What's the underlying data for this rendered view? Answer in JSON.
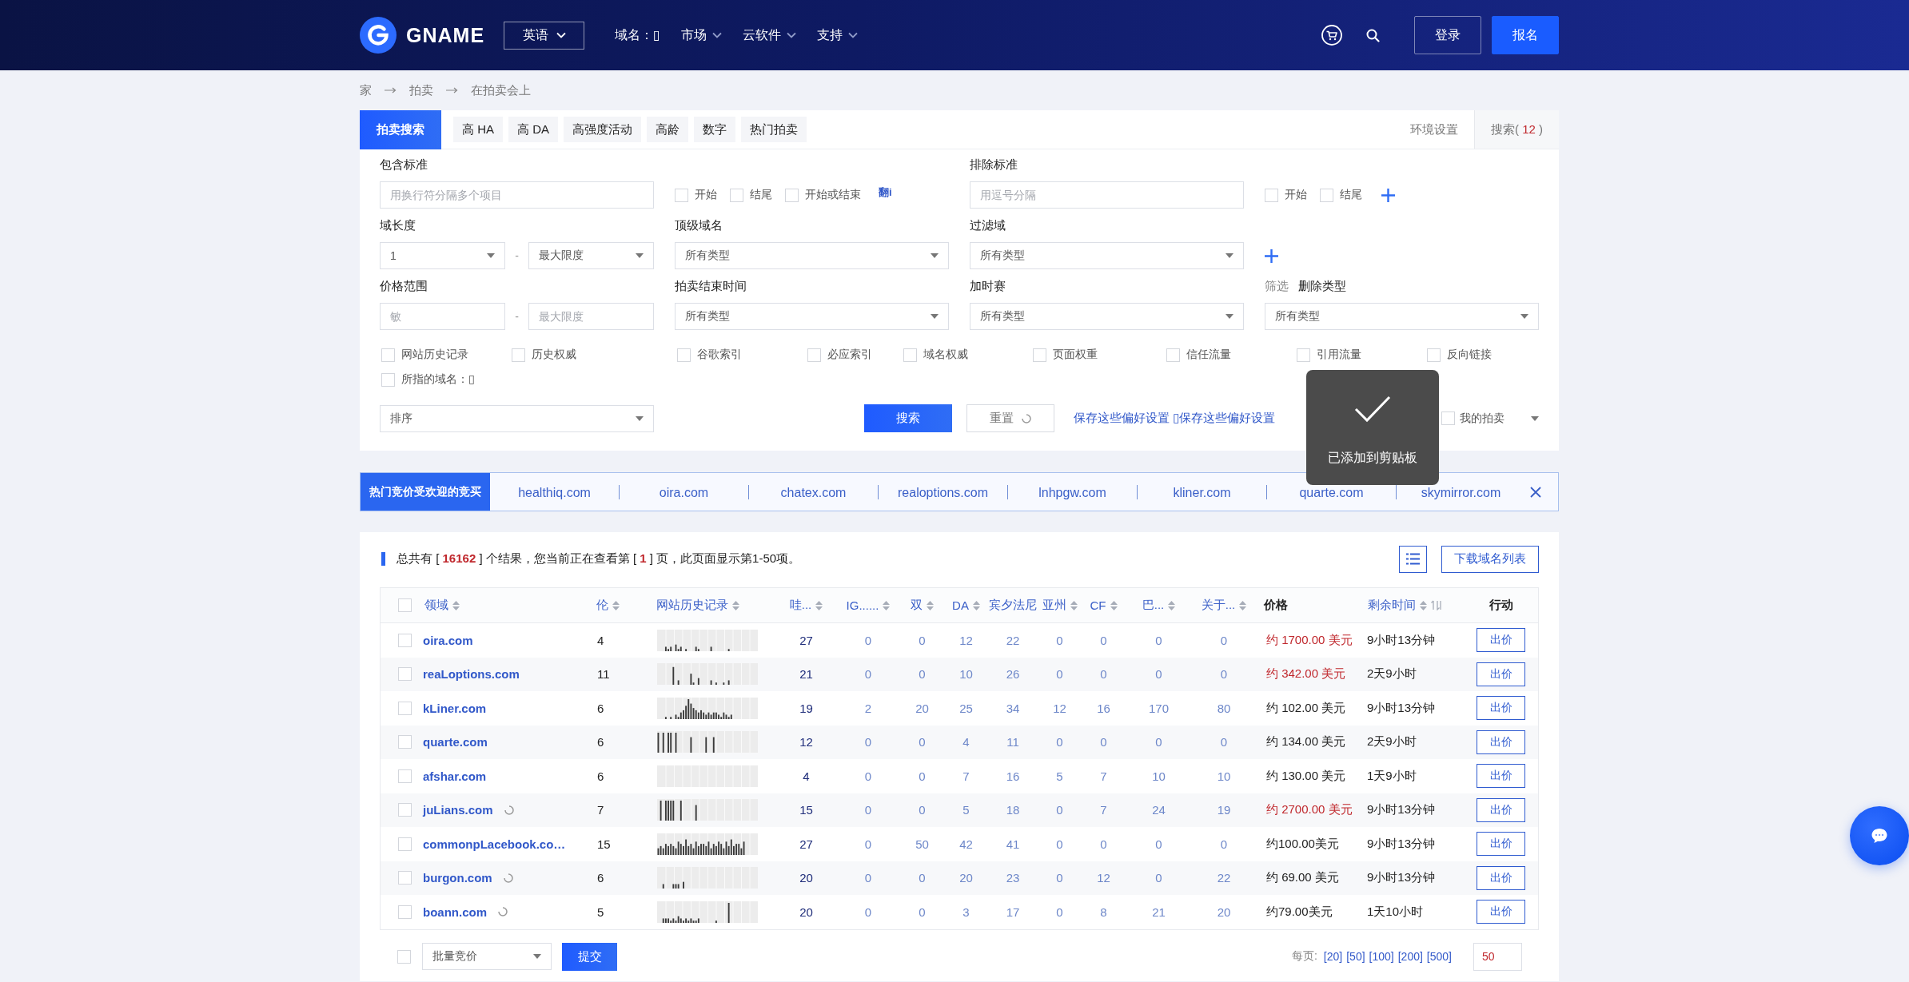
{
  "header": {
    "logo": "GNAME",
    "language": "英语",
    "nav": [
      {
        "label": "域名：▯",
        "dropdown": false
      },
      {
        "label": "市场",
        "dropdown": true
      },
      {
        "label": "云软件",
        "dropdown": true
      },
      {
        "label": "支持",
        "dropdown": true
      }
    ],
    "login": "登录",
    "signup": "报名"
  },
  "breadcrumb": [
    "家",
    "拍卖",
    "在拍卖会上"
  ],
  "tabs": [
    {
      "label": "拍卖搜索",
      "selected": true
    },
    {
      "label": "高 HA",
      "selected": false
    },
    {
      "label": "高 DA",
      "selected": false
    },
    {
      "label": "高强度活动",
      "selected": false
    },
    {
      "label": "高龄",
      "selected": false
    },
    {
      "label": "数字",
      "selected": false
    },
    {
      "label": "热门拍卖",
      "selected": false
    }
  ],
  "settings": "环境设置",
  "saved_searches": {
    "label": "搜索(",
    "count": "12",
    "suffix": ")"
  },
  "filters": {
    "include": {
      "label": "包含标准",
      "placeholder": "用换行符分隔多个项目",
      "options": [
        {
          "label": "开始",
          "checked": false
        },
        {
          "label": "结尾",
          "checked": false
        },
        {
          "label": "开始或结束",
          "checked": false
        }
      ],
      "link": "翻i"
    },
    "exclude": {
      "label": "排除标准",
      "placeholder": "用逗号分隔",
      "options": [
        {
          "label": "开始",
          "checked": false
        },
        {
          "label": "结尾",
          "checked": false
        }
      ]
    },
    "length": {
      "label": "域长度",
      "min": "1",
      "separator": "-",
      "max": "最大限度"
    },
    "tld": {
      "label": "顶级域名",
      "value": "所有类型"
    },
    "filter_domain": {
      "label": "过滤域",
      "value": "所有类型"
    },
    "price": {
      "label": "价格范围",
      "min_placeholder": "敏",
      "separator": "-",
      "max_placeholder": "最大限度"
    },
    "end_time": {
      "label": "拍卖结束时间",
      "value": "所有类型"
    },
    "overtime": {
      "label": "加时赛",
      "value": "所有类型"
    },
    "delete_type": {
      "prefix": "筛选",
      "label": "删除类型",
      "value": "所有类型"
    },
    "metrics": [
      {
        "label": "网站历史记录",
        "checked": false
      },
      {
        "label": "历史权威",
        "checked": false
      },
      {
        "label": "谷歌索引",
        "checked": false
      },
      {
        "label": "必应索引",
        "checked": false
      },
      {
        "label": "域名权威",
        "checked": false
      },
      {
        "label": "页面权重",
        "checked": false
      },
      {
        "label": "信任流量",
        "checked": false
      },
      {
        "label": "引用流量",
        "checked": false
      },
      {
        "label": "反向链接",
        "checked": false
      }
    ],
    "referred": {
      "label": "所指的域名：▯",
      "checked": false
    },
    "sort": {
      "value": "排序"
    },
    "search": "搜索",
    "reset": "重置",
    "save": "保存这些偏好设置 ▯保存这些偏好设置",
    "my_auctions": {
      "label": "我的拍卖",
      "checked": false
    }
  },
  "toast": {
    "message": "已添加到剪贴板"
  },
  "hot_auctions": {
    "label": "热门竞价受欢迎的竞买",
    "domains": [
      "healthiq.com",
      "oira.com",
      "chatex.com",
      "realoptions.com",
      "lnhpgw.com",
      "kliner.com",
      "quarte.com",
      "skymirror.com"
    ]
  },
  "results": {
    "summary": "总共有 [ **16162** ] 个结果，您当前正在查看第 [ **1** ] 页，此页面显示第1-50项。",
    "download": "下载域名列表"
  },
  "table": {
    "select_all": {
      "checked": false
    },
    "columns": [
      {
        "label": "领域",
        "kind": "sort"
      },
      {
        "label": "伦",
        "kind": "sort"
      },
      {
        "label": "网站历史记录",
        "kind": "sort"
      },
      {
        "label": "哇...",
        "kind": "sort"
      },
      {
        "label": "IG......",
        "kind": "sort"
      },
      {
        "label": "双",
        "kind": "sort"
      },
      {
        "label": "DA",
        "kind": "sort"
      },
      {
        "label": "宾夕法尼",
        "kind": "label"
      },
      {
        "label": "亚州",
        "kind": "sort"
      },
      {
        "label": "CF",
        "kind": "sort"
      },
      {
        "label": "巴...",
        "kind": "sort"
      },
      {
        "label": "关于...",
        "kind": "sort"
      },
      {
        "label": "价格",
        "kind": "plain"
      },
      {
        "label": "剩余时间",
        "kind": "toggle"
      },
      {
        "label": "行动",
        "kind": "plain"
      }
    ],
    "rows": [
      {
        "checked": false,
        "domain": "oira.com",
        "loading": false,
        "length": "4",
        "stats": [
          "27",
          "0",
          "0",
          "12",
          "22",
          "0",
          "0",
          "0",
          "0"
        ],
        "price": "约 1700.00 美元",
        "hot_price": true,
        "time_left": "9小时13分钟",
        "bid": "出价"
      },
      {
        "checked": false,
        "domain": "reaLoptions.com",
        "loading": false,
        "length": "11",
        "stats": [
          "21",
          "0",
          "0",
          "10",
          "26",
          "0",
          "0",
          "0",
          "0"
        ],
        "price": "约 342.00 美元",
        "hot_price": true,
        "time_left": "2天9小时",
        "bid": "出价"
      },
      {
        "checked": false,
        "domain": "kLiner.com",
        "loading": false,
        "length": "6",
        "stats": [
          "19",
          "2",
          "20",
          "25",
          "34",
          "12",
          "16",
          "170",
          "80"
        ],
        "price": "约 102.00 美元",
        "hot_price": false,
        "time_left": "9小时13分钟",
        "bid": "出价"
      },
      {
        "checked": false,
        "domain": "quarte.com",
        "loading": false,
        "length": "6",
        "stats": [
          "12",
          "0",
          "0",
          "4",
          "11",
          "0",
          "0",
          "0",
          "0"
        ],
        "price": "约 134.00 美元",
        "hot_price": false,
        "time_left": "2天9小时",
        "bid": "出价"
      },
      {
        "checked": false,
        "domain": "afshar.com",
        "loading": false,
        "length": "6",
        "stats": [
          "4",
          "0",
          "0",
          "7",
          "16",
          "5",
          "7",
          "10",
          "10"
        ],
        "price": "约 130.00 美元",
        "hot_price": false,
        "time_left": "1天9小时",
        "bid": "出价"
      },
      {
        "checked": false,
        "domain": "juLians.com",
        "loading": true,
        "length": "7",
        "stats": [
          "15",
          "0",
          "0",
          "5",
          "18",
          "0",
          "7",
          "24",
          "19"
        ],
        "price": "约 2700.00 美元",
        "hot_price": true,
        "time_left": "9小时13分钟",
        "bid": "出价"
      },
      {
        "checked": false,
        "domain": "commonpLacebook.co…",
        "loading": false,
        "length": "15",
        "stats": [
          "27",
          "0",
          "50",
          "42",
          "41",
          "0",
          "0",
          "0",
          "0"
        ],
        "price": "约100.00美元",
        "hot_price": false,
        "time_left": "9小时13分钟",
        "bid": "出价"
      },
      {
        "checked": false,
        "domain": "burgon.com",
        "loading": true,
        "length": "6",
        "stats": [
          "20",
          "0",
          "0",
          "20",
          "23",
          "0",
          "12",
          "0",
          "22"
        ],
        "price": "约 69.00 美元",
        "hot_price": false,
        "time_left": "9小时13分钟",
        "bid": "出价"
      },
      {
        "checked": false,
        "domain": "boann.com",
        "loading": true,
        "length": "5",
        "stats": [
          "20",
          "0",
          "0",
          "3",
          "17",
          "0",
          "8",
          "21",
          "20"
        ],
        "price": "约79.00美元",
        "hot_price": false,
        "time_left": "1天10小时",
        "bid": "出价"
      }
    ]
  },
  "footer": {
    "select_all": {
      "checked": false
    },
    "bulk_action": "批量竞价",
    "submit": "提交",
    "per_page_label": "每页:",
    "per_page_options": [
      "[20]",
      "[50]",
      "[100]",
      "[200]",
      "[500]"
    ],
    "page_size": "50"
  }
}
